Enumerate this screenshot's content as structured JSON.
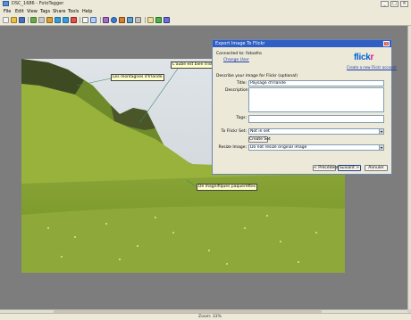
{
  "app": {
    "title": "DSC_1686 - FotoTagger"
  },
  "menu": [
    "File",
    "Edit",
    "View",
    "Tags",
    "Share",
    "Tools",
    "Help"
  ],
  "status": {
    "zoom": "Zoom: 33%"
  },
  "photo": {
    "notes": [
      "Les montagnes d'Irlande",
      "L'aube est bien triste",
      "De magnifiques paquerettes"
    ]
  },
  "dialog": {
    "title": "Export Image To Flickr",
    "connected_label": "Connected to: fotoafro",
    "change_user": "Change User",
    "create_account": "Create a new Flickr account",
    "logo_main": "flickr",
    "logo_accent": "r",
    "describe_label": "Describe your image for Flickr (optional)",
    "title_label": "Title:",
    "title_value": "Paysage d'Irlande",
    "description_label": "Description:",
    "description_value": "",
    "tags_label": "Tags:",
    "tags_value": "",
    "set_label": "To Flickr Set:",
    "set_value": "Not in set",
    "create_set": "Create Set",
    "resize_label": "Resize Image:",
    "resize_value": "Do not resize original image",
    "prev_button": "< Précédent",
    "next_button": "Suivant >",
    "cancel_button": "Annuler"
  },
  "colors": {
    "dialog_title": "#2f5ec4",
    "note_bg": "#ffffcc",
    "flickr_blue": "#0063dc",
    "flickr_pink": "#ff0084"
  }
}
